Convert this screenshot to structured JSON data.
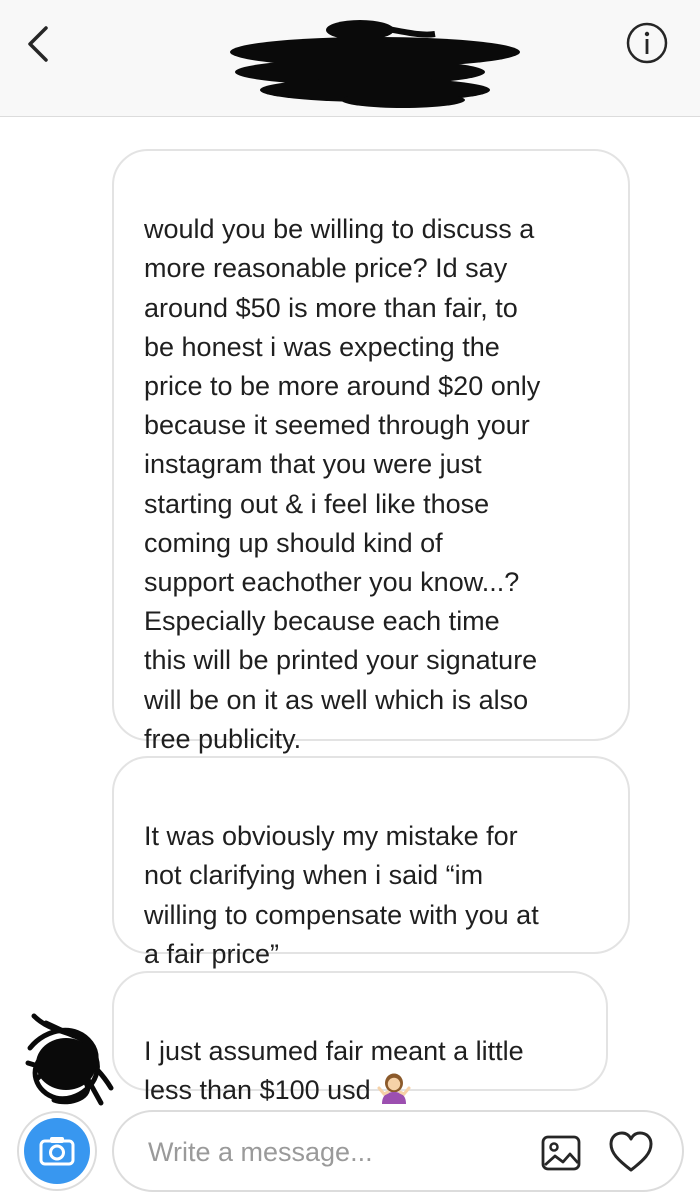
{
  "header": {
    "back_icon": "chevron-left-icon",
    "info_icon": "info-circle-icon",
    "title_redacted": true
  },
  "messages": [
    {
      "text": "would you be willing to discuss a\nmore reasonable price? Id say\naround $50 is more than fair, to\nbe honest i was expecting the\nprice to be more around $20 only\nbecause it seemed through your\ninstagram that you were just\nstarting out & i feel like those\ncoming up should kind of\nsupport eachother you know...?\nEspecially because each time\nthis will be printed your signature\nwill be on it as well which is also\nfree publicity."
    },
    {
      "text": "It was obviously my mistake for\nnot clarifying when i said “im\nwilling to compensate with you at\na fair price”"
    },
    {
      "text": "I just assumed fair meant a little\nless than $100 usd",
      "emoji": "woman-shrugging-emoji"
    }
  ],
  "composer": {
    "placeholder": "Write a message...",
    "camera_icon": "camera-icon",
    "gallery_icon": "gallery-icon",
    "heart_icon": "heart-icon"
  },
  "colors": {
    "header_bg": "#f8f8f8",
    "bubble_border": "#e3e3e3",
    "camera_blue": "#3897f0",
    "text": "#262626",
    "placeholder": "#9a9a9a"
  }
}
